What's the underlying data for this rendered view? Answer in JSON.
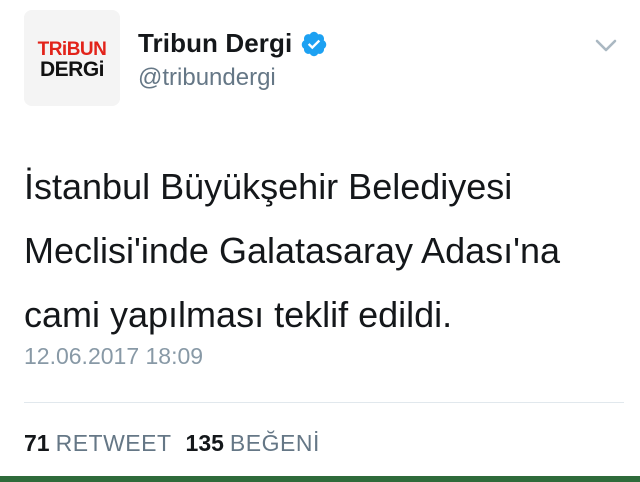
{
  "profile": {
    "display_name": "Tribun Dergi",
    "handle": "@tribundergi",
    "verified_icon": "verified-badge-icon",
    "avatar_logo_lines": [
      "TRiBUN",
      "DERGi"
    ],
    "colors": {
      "logo_red": "#e2231a",
      "logo_black": "#111111",
      "verified_blue": "#1da1f2"
    }
  },
  "menu": {
    "icon": "chevron-down-icon"
  },
  "tweet": {
    "text": "İstanbul Büyükşehir Belediyesi\nMeclisi'inde Galatasaray Adası'na\ncami yapılması teklif edildi.",
    "timestamp": "12.06.2017 18:09"
  },
  "stats": {
    "retweets_count": "71",
    "retweets_label": "RETWEET",
    "likes_count": "135",
    "likes_label": "BEĞENİ"
  }
}
